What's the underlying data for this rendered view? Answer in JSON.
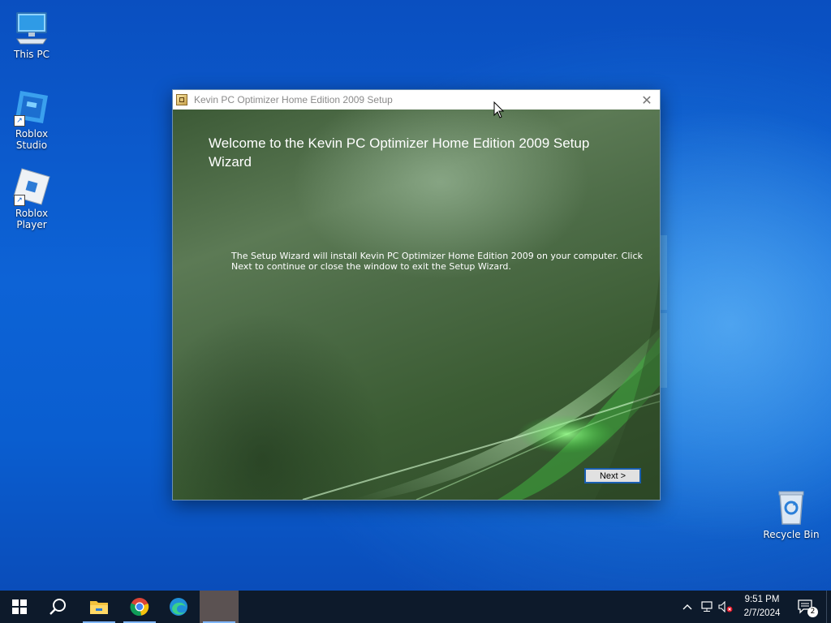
{
  "desktop": {
    "icons": [
      {
        "label": "This PC"
      },
      {
        "label": "Roblox Studio"
      },
      {
        "label": "Roblox Player"
      },
      {
        "label": "Recycle Bin"
      }
    ]
  },
  "window": {
    "title": "Kevin PC Optimizer Home Edition 2009 Setup",
    "close_glyph": "✕",
    "heading": "Welcome to the Kevin PC Optimizer Home Edition 2009 Setup Wizard",
    "body": "The Setup Wizard will install Kevin PC Optimizer Home Edition 2009 on your computer. Click Next to continue or close the window to exit the Setup Wizard.",
    "next_label": "Next >"
  },
  "taskbar": {
    "apps": [
      {
        "icon": "windows-start-icon"
      },
      {
        "icon": "search-icon"
      },
      {
        "icon": "file-explorer-icon"
      },
      {
        "icon": "chrome-icon"
      },
      {
        "icon": "edge-icon"
      },
      {
        "icon": "setup-app-icon"
      }
    ],
    "time": "9:51 PM",
    "date": "2/7/2024",
    "notification_count": "2"
  },
  "colors": {
    "desktop_blue": "#0d63d6",
    "taskbar": "#0d1a2b",
    "button_border": "#1a5fb0"
  }
}
